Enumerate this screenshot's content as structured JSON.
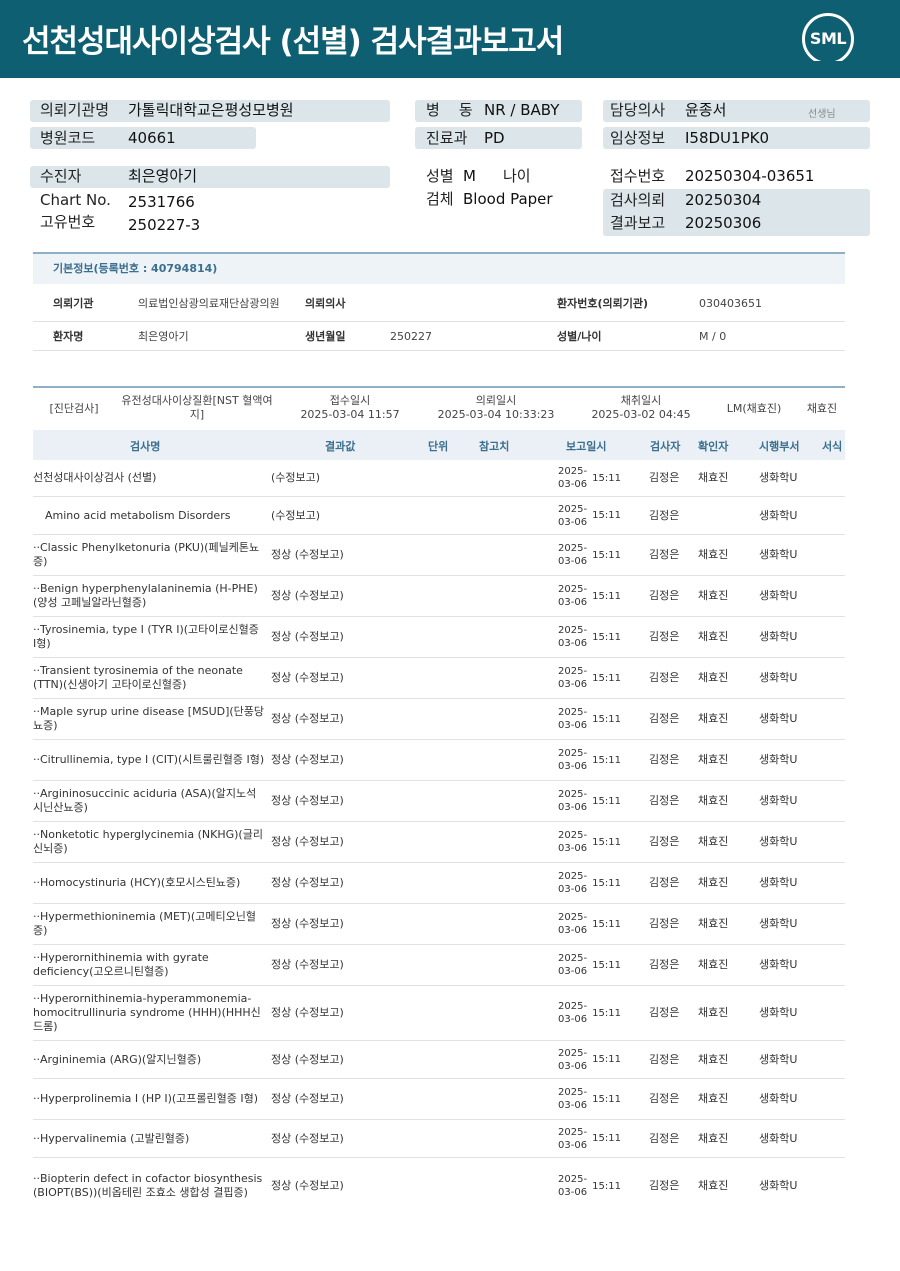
{
  "report": {
    "title": "선천성대사이상검사 (선별) 검사결과보고서",
    "logo": "SML"
  },
  "info": {
    "institution_label": "의뢰기관명",
    "institution": "가톨릭대학교은평성모병원",
    "code_label": "병원코드",
    "code": "40661",
    "ward_label": "병    동",
    "ward": "NR / BABY",
    "dept_label": "진료과",
    "dept": "PD",
    "doctor_label": "담당의사",
    "doctor": "윤종서",
    "doctor_note": "선생님",
    "clinical_label": "임상정보",
    "clinical": "I58DU1PK0",
    "patient_label": "수진자",
    "patient": "최은영아기",
    "chart_label": "Chart No.",
    "chart": "2531766",
    "uid_label": "고유번호",
    "uid": "250227-3",
    "sex_label": "성별",
    "sex": "M",
    "age_label": "나이",
    "age": "",
    "specimen_label": "검체",
    "specimen": "Blood Paper",
    "receipt_label": "접수번호",
    "receipt": "20250304-03651",
    "request_label": "검사의뢰",
    "request": "20250304",
    "result_label": "결과보고",
    "result": "20250306"
  },
  "basic": {
    "header": "기본정보(등록번호 : 40794814)",
    "inst_label": "의뢰기관",
    "inst": "의료법인삼광의료재단삼광의원",
    "doc_label": "의뢰의사",
    "doc": "",
    "pid_label": "환자번호(의뢰기관)",
    "pid": "030403651",
    "name_label": "환자명",
    "name": "최은영아기",
    "dob_label": "생년월일",
    "dob": "250227",
    "sexage_label": "성별/나이",
    "sexage": "M / 0"
  },
  "order": {
    "category": "[진단검사]",
    "disease": "유전성대사이상질환[NST 혈액여지]",
    "received_label": "접수일시",
    "received": "2025-03-04 11:57",
    "requested_label": "의뢰일시",
    "requested": "2025-03-04 10:33:23",
    "collected_label": "채취일시",
    "collected": "2025-03-02 04:45",
    "lm": "LM(채효진)",
    "signer": "채효진"
  },
  "table": {
    "headers": {
      "name": "검사명",
      "result": "결과값",
      "unit": "단위",
      "ref": "참고치",
      "date": "보고일시",
      "tester": "검사자",
      "confirmer": "확인자",
      "dept": "시행부서",
      "format": "서식"
    },
    "rows": [
      {
        "name": "선천성대사이상검사 (선별)",
        "result": "(수정보고)",
        "date": "2025-03-06",
        "time": "15:11",
        "tester": "김정은",
        "confirmer": "채효진",
        "dept": "생화학U"
      },
      {
        "name": "Amino acid metabolism Disorders",
        "result": "(수정보고)",
        "date": "2025-03-06",
        "time": "15:11",
        "tester": "김정은",
        "confirmer": "",
        "dept": "생화학U"
      },
      {
        "name": "··Classic Phenylketonuria (PKU)(페닐케톤뇨증)",
        "result": "정상 (수정보고)",
        "date": "2025-03-06",
        "time": "15:11",
        "tester": "김정은",
        "confirmer": "채효진",
        "dept": "생화학U"
      },
      {
        "name": "··Benign hyperphenylalaninemia (H-PHE)(양성 고페닐알라닌혈증)",
        "result": "정상 (수정보고)",
        "date": "2025-03-06",
        "time": "15:11",
        "tester": "김정은",
        "confirmer": "채효진",
        "dept": "생화학U"
      },
      {
        "name": "··Tyrosinemia, type I (TYR I)(고타이로신혈증 I형)",
        "result": "정상 (수정보고)",
        "date": "2025-03-06",
        "time": "15:11",
        "tester": "김정은",
        "confirmer": "채효진",
        "dept": "생화학U"
      },
      {
        "name": "··Transient tyrosinemia of the neonate (TTN)(신생아기 고타이로신혈증)",
        "result": "정상 (수정보고)",
        "date": "2025-03-06",
        "time": "15:11",
        "tester": "김정은",
        "confirmer": "채효진",
        "dept": "생화학U"
      },
      {
        "name": "··Maple syrup urine disease [MSUD](단풍당뇨증)",
        "result": "정상 (수정보고)",
        "date": "2025-03-06",
        "time": "15:11",
        "tester": "김정은",
        "confirmer": "채효진",
        "dept": "생화학U"
      },
      {
        "name": "··Citrullinemia, type I (CIT)(시트룰린혈증 I형)",
        "result": "정상 (수정보고)",
        "date": "2025-03-06",
        "time": "15:11",
        "tester": "김정은",
        "confirmer": "채효진",
        "dept": "생화학U"
      },
      {
        "name": "··Argininosuccinic aciduria (ASA)(알지노석시닌산뇨증)",
        "result": "정상 (수정보고)",
        "date": "2025-03-06",
        "time": "15:11",
        "tester": "김정은",
        "confirmer": "채효진",
        "dept": "생화학U"
      },
      {
        "name": "··Nonketotic hyperglycinemia (NKHG)(글리신뇌증)",
        "result": "정상 (수정보고)",
        "date": "2025-03-06",
        "time": "15:11",
        "tester": "김정은",
        "confirmer": "채효진",
        "dept": "생화학U"
      },
      {
        "name": "··Homocystinuria (HCY)(호모시스틴뇨증)",
        "result": "정상 (수정보고)",
        "date": "2025-03-06",
        "time": "15:11",
        "tester": "김정은",
        "confirmer": "채효진",
        "dept": "생화학U"
      },
      {
        "name": "··Hypermethioninemia (MET)(고메티오닌혈증)",
        "result": "정상 (수정보고)",
        "date": "2025-03-06",
        "time": "15:11",
        "tester": "김정은",
        "confirmer": "채효진",
        "dept": "생화학U"
      },
      {
        "name": "··Hyperornithinemia with gyrate deficiency(고오르니틴혈증)",
        "result": "정상 (수정보고)",
        "date": "2025-03-06",
        "time": "15:11",
        "tester": "김정은",
        "confirmer": "채효진",
        "dept": "생화학U"
      },
      {
        "name": "··Hyperornithinemia-hyperammonemia-homocitrullinuria syndrome (HHH)(HHH신드롬)",
        "result": "정상 (수정보고)",
        "date": "2025-03-06",
        "time": "15:11",
        "tester": "김정은",
        "confirmer": "채효진",
        "dept": "생화학U"
      },
      {
        "name": "··Argininemia (ARG)(알지닌혈증)",
        "result": "정상 (수정보고)",
        "date": "2025-03-06",
        "time": "15:11",
        "tester": "김정은",
        "confirmer": "채효진",
        "dept": "생화학U"
      },
      {
        "name": "··Hyperprolinemia I (HP I)(고프롤린혈증 I형)",
        "result": "정상 (수정보고)",
        "date": "2025-03-06",
        "time": "15:11",
        "tester": "김정은",
        "confirmer": "채효진",
        "dept": "생화학U"
      },
      {
        "name": "··Hypervalinemia (고발린혈증)",
        "result": "정상 (수정보고)",
        "date": "2025-03-06",
        "time": "15:11",
        "tester": "김정은",
        "confirmer": "채효진",
        "dept": "생화학U"
      },
      {
        "name": "··Biopterin defect in cofactor biosynthesis (BIOPT(BS))(비옵테린 조효소 생합성 결핍증)",
        "result": "정상 (수정보고)",
        "date": "2025-03-06",
        "time": "15:11",
        "tester": "김정은",
        "confirmer": "채효진",
        "dept": "생화학U"
      }
    ]
  }
}
